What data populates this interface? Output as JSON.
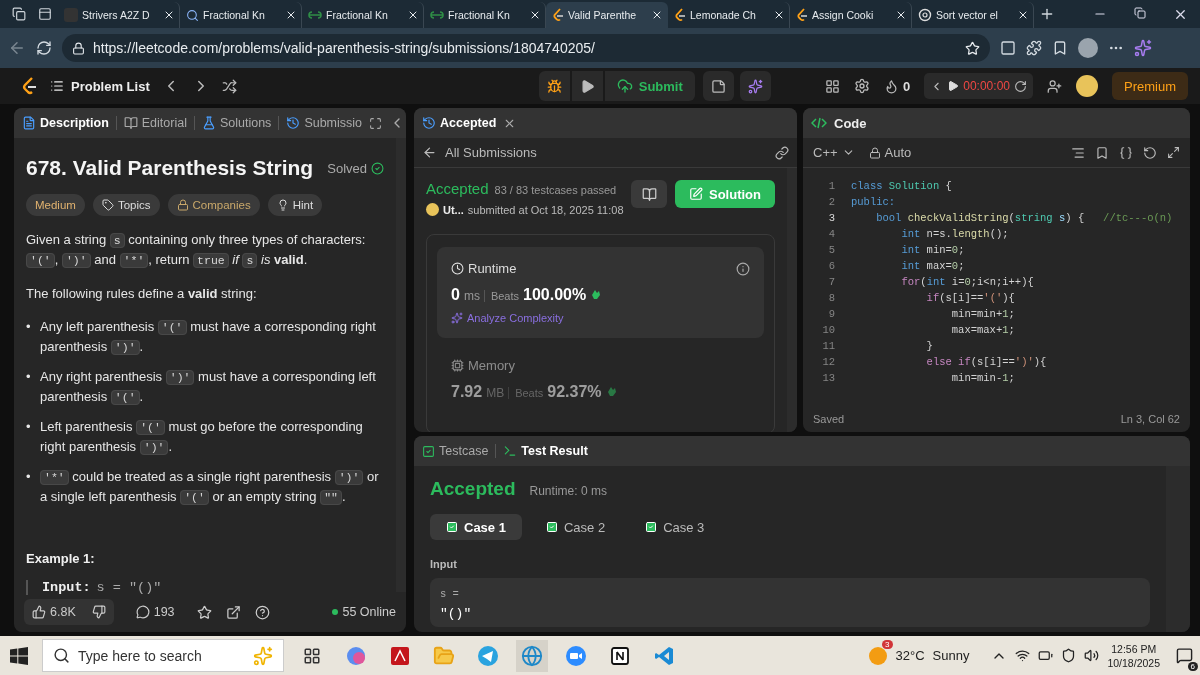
{
  "browser": {
    "tabs": [
      {
        "label": "Strivers A2Z D",
        "kind": "square",
        "selected": false
      },
      {
        "label": "Fractional Kn",
        "kind": "search",
        "selected": false
      },
      {
        "label": "Fractional Kn",
        "kind": "gfg",
        "selected": false
      },
      {
        "label": "Fractional Kn",
        "kind": "gfg",
        "selected": false
      },
      {
        "label": "Valid Parenthe",
        "kind": "leetcode",
        "selected": true
      },
      {
        "label": "Lemonade Ch",
        "kind": "leetcode",
        "selected": false
      },
      {
        "label": "Assign Cooki",
        "kind": "leetcode",
        "selected": false
      },
      {
        "label": "Sort vector el",
        "kind": "chatgpt",
        "selected": false
      }
    ],
    "url": "https://leetcode.com/problems/valid-parenthesis-string/submissions/1804740205/"
  },
  "nav": {
    "problem_list": "Problem List",
    "submit": "Submit",
    "streak": "0",
    "timer": "00:00:00",
    "premium": "Premium"
  },
  "description_panel": {
    "tabs": [
      {
        "label": "Description",
        "kind": "doc",
        "selected": true
      },
      {
        "label": "Editorial",
        "kind": "book",
        "selected": false
      },
      {
        "label": "Solutions",
        "kind": "flask",
        "selected": false
      },
      {
        "label": "Submissio",
        "kind": "history",
        "selected": false
      }
    ],
    "title": "678. Valid Parenthesis String",
    "status": "Solved",
    "tags": [
      {
        "label": "Medium",
        "kind": "difficulty"
      },
      {
        "label": "Topics",
        "kind": "tag"
      },
      {
        "label": "Companies",
        "kind": "lock"
      },
      {
        "label": "Hint",
        "kind": "hint"
      }
    ],
    "statement": [
      {
        "kind": "text",
        "text": "Given a string "
      },
      {
        "kind": "code",
        "text": "s"
      },
      {
        "kind": "text",
        "text": " containing only three types of characters: "
      },
      {
        "kind": "code",
        "text": "'('"
      },
      {
        "kind": "text",
        "text": ", "
      },
      {
        "kind": "code",
        "text": "')'"
      },
      {
        "kind": "text",
        "text": " and "
      },
      {
        "kind": "code",
        "text": "'*'"
      },
      {
        "kind": "text",
        "text": ", return "
      },
      {
        "kind": "code",
        "text": "true"
      },
      {
        "kind": "text",
        "text": " *if* "
      },
      {
        "kind": "code",
        "text": "s"
      },
      {
        "kind": "text",
        "text": " *is* **valid**."
      }
    ],
    "rules_intro": "The following rules define a **valid** string:",
    "rules": [
      {
        "marker": "•",
        "segments": [
          {
            "kind": "text",
            "text": "Any left parenthesis "
          },
          {
            "kind": "code",
            "text": "'('"
          },
          {
            "kind": "text",
            "text": " must have a corresponding right parenthesis "
          },
          {
            "kind": "code",
            "text": "')'"
          },
          {
            "kind": "text",
            "text": "."
          }
        ]
      },
      {
        "marker": "•",
        "segments": [
          {
            "kind": "text",
            "text": "Any right parenthesis "
          },
          {
            "kind": "code",
            "text": "')'"
          },
          {
            "kind": "text",
            "text": " must have a corresponding left parenthesis "
          },
          {
            "kind": "code",
            "text": "'('"
          },
          {
            "kind": "text",
            "text": "."
          }
        ]
      },
      {
        "marker": "•",
        "segments": [
          {
            "kind": "text",
            "text": "Left parenthesis "
          },
          {
            "kind": "code",
            "text": "'('"
          },
          {
            "kind": "text",
            "text": " must go before the corresponding right parenthesis "
          },
          {
            "kind": "code",
            "text": "')'"
          },
          {
            "kind": "text",
            "text": "."
          }
        ]
      },
      {
        "marker": "•",
        "segments": [
          {
            "kind": "code",
            "text": "'*'"
          },
          {
            "kind": "text",
            "text": " could be treated as a single right parenthesis "
          },
          {
            "kind": "code",
            "text": "')'"
          },
          {
            "kind": "text",
            "text": " or a single left parenthesis "
          },
          {
            "kind": "code",
            "text": "'('"
          },
          {
            "kind": "text",
            "text": " or an empty string "
          },
          {
            "kind": "code",
            "text": "\"\""
          },
          {
            "kind": "text",
            "text": "."
          }
        ]
      }
    ],
    "example_heading": "Example 1:",
    "example_label": "Input:",
    "example_value": "s = \"()\"",
    "footer": {
      "likes": "6.8K",
      "comments": "193",
      "online": "55 Online"
    }
  },
  "submission_panel": {
    "tab": "Accepted",
    "back": "All Submissions",
    "status": "Accepted",
    "testcases": "83 / 83 testcases passed",
    "user": "Ut...",
    "submitted": "submitted at Oct 18, 2025 11:08",
    "solution_button": "Solution",
    "metrics": [
      {
        "label": "Runtime",
        "kind": "clock",
        "value": "0",
        "unit": "ms",
        "beats_label": "Beats",
        "beats": "100.00%",
        "selected": true
      },
      {
        "label": "Memory",
        "kind": "chip",
        "value": "7.92",
        "unit": "MB",
        "beats_label": "Beats",
        "beats": "92.37%",
        "selected": false
      }
    ],
    "analyze": "Analyze Complexity"
  },
  "code_panel": {
    "title": "Code",
    "language": "C++",
    "mode": "Auto",
    "lines": [
      {
        "number": "1",
        "current": false,
        "tokens": [
          {
            "kind": "keyword",
            "text": "class"
          },
          {
            "kind": "type",
            "text": " Solution"
          },
          {
            "kind": "plain",
            "text": " {"
          }
        ]
      },
      {
        "number": "2",
        "current": false,
        "tokens": [
          {
            "kind": "keyword",
            "text": "public:"
          }
        ]
      },
      {
        "number": "3",
        "current": true,
        "tokens": [
          {
            "kind": "keyword",
            "text": "    bool"
          },
          {
            "kind": "function",
            "text": " checkValidString"
          },
          {
            "kind": "plain",
            "text": "("
          },
          {
            "kind": "type",
            "text": "string"
          },
          {
            "kind": "variable",
            "text": " s"
          },
          {
            "kind": "plain",
            "text": ") {"
          },
          {
            "kind": "comment",
            "text": "   //tc---o(n)"
          }
        ]
      },
      {
        "number": "4",
        "current": false,
        "tokens": [
          {
            "kind": "keyword",
            "text": "        int"
          },
          {
            "kind": "plain",
            "text": " n=s."
          },
          {
            "kind": "function",
            "text": "length"
          },
          {
            "kind": "plain",
            "text": "();"
          }
        ]
      },
      {
        "number": "5",
        "current": false,
        "tokens": [
          {
            "kind": "keyword",
            "text": "        int"
          },
          {
            "kind": "plain",
            "text": " min="
          },
          {
            "kind": "number",
            "text": "0"
          },
          {
            "kind": "plain",
            "text": ";"
          }
        ]
      },
      {
        "number": "6",
        "current": false,
        "tokens": [
          {
            "kind": "keyword",
            "text": "        int"
          },
          {
            "kind": "plain",
            "text": " max="
          },
          {
            "kind": "number",
            "text": "0"
          },
          {
            "kind": "plain",
            "text": ";"
          }
        ]
      },
      {
        "number": "7",
        "current": false,
        "tokens": [
          {
            "kind": "control",
            "text": "        for"
          },
          {
            "kind": "plain",
            "text": "("
          },
          {
            "kind": "keyword",
            "text": "int"
          },
          {
            "kind": "plain",
            "text": " i="
          },
          {
            "kind": "number",
            "text": "0"
          },
          {
            "kind": "plain",
            "text": ";i<n;i++){"
          }
        ]
      },
      {
        "number": "8",
        "current": false,
        "tokens": [
          {
            "kind": "control",
            "text": "            if"
          },
          {
            "kind": "plain",
            "text": "(s[i]=="
          },
          {
            "kind": "string",
            "text": "'('"
          },
          {
            "kind": "plain",
            "text": "){"
          }
        ]
      },
      {
        "number": "9",
        "current": false,
        "tokens": [
          {
            "kind": "plain",
            "text": "                min=min+"
          },
          {
            "kind": "number",
            "text": "1"
          },
          {
            "kind": "plain",
            "text": ";"
          }
        ]
      },
      {
        "number": "10",
        "current": false,
        "tokens": [
          {
            "kind": "plain",
            "text": "                max=max+"
          },
          {
            "kind": "number",
            "text": "1"
          },
          {
            "kind": "plain",
            "text": ";"
          }
        ]
      },
      {
        "number": "11",
        "current": false,
        "tokens": [
          {
            "kind": "plain",
            "text": "            }"
          }
        ]
      },
      {
        "number": "12",
        "current": false,
        "tokens": [
          {
            "kind": "control",
            "text": "            else if"
          },
          {
            "kind": "plain",
            "text": "(s[i]=="
          },
          {
            "kind": "string",
            "text": "')'"
          },
          {
            "kind": "plain",
            "text": "){"
          }
        ]
      },
      {
        "number": "13",
        "current": false,
        "tokens": [
          {
            "kind": "plain",
            "text": "                min=min-"
          },
          {
            "kind": "number",
            "text": "1"
          },
          {
            "kind": "plain",
            "text": ";"
          }
        ]
      }
    ],
    "status": "Saved",
    "cursor": "Ln 3, Col 62"
  },
  "test_panel": {
    "tabs": [
      {
        "label": "Testcase",
        "kind": "check",
        "selected": false
      },
      {
        "label": "Test Result",
        "kind": "terminal",
        "selected": true
      }
    ],
    "status": "Accepted",
    "runtime": "Runtime: 0 ms",
    "cases": [
      {
        "label": "Case 1",
        "selected": true
      },
      {
        "label": "Case 2",
        "selected": false
      },
      {
        "label": "Case 3",
        "selected": false
      }
    ],
    "input_label": "Input",
    "variable": "s =",
    "value": "\"()\""
  },
  "taskbar": {
    "search_placeholder": "Type here to search",
    "weather_badge": "3",
    "temperature": "32°C",
    "condition": "Sunny",
    "time": "12:56 PM",
    "date": "10/18/2025",
    "notifications": "6"
  }
}
